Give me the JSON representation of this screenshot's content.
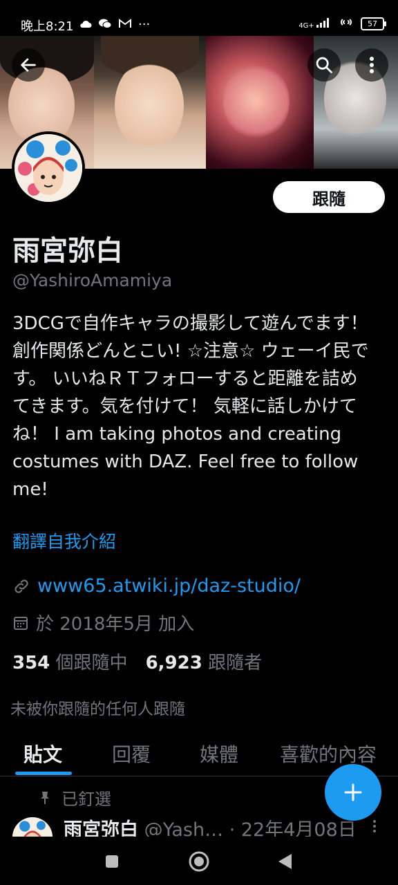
{
  "status": {
    "time": "晚上8:21",
    "network": "4G+",
    "battery": "57"
  },
  "profile": {
    "display_name": "雨宮弥白",
    "handle": "@YashiroAmamiya",
    "bio": "3DCGで自作キャラの撮影して遊んでます！創作関係どんとこい! ☆注意☆ ウェーイ民です。 いいねＲＴフォローすると距離を詰めてきます。気を付けて！ 気軽に話しかけてね！ I am taking photos and creating costumes with DAZ. Feel free to follow me!",
    "translate_label": "翻譯自我介紹",
    "website": "www65.atwiki.jp/daz-studio/",
    "joined": "於 2018年5月 加入",
    "following_count": "354",
    "following_label": "個跟隨中",
    "followers_count": "6,923",
    "followers_label": "跟隨者",
    "not_followed_note": "未被你跟隨的任何人跟隨",
    "follow_button": "跟隨"
  },
  "tabs": [
    {
      "label": "貼文",
      "active": true
    },
    {
      "label": "回覆",
      "active": false
    },
    {
      "label": "媒體",
      "active": false
    },
    {
      "label": "喜歡的內容",
      "active": false
    }
  ],
  "pinned_tweet": {
    "pinned_label": "已釘選",
    "name": "雨宮弥白",
    "handle": "@Yash…",
    "date": "· 22年4月08日"
  },
  "colors": {
    "accent": "#1d9bf0",
    "background": "#000000",
    "text_primary": "#e7e9ea",
    "text_secondary": "#71767b"
  },
  "icons": [
    "back-arrow-icon",
    "search-icon",
    "more-vertical-icon",
    "link-icon",
    "calendar-icon",
    "pin-icon",
    "compose-plus-icon",
    "nav-recents-icon",
    "nav-home-icon",
    "nav-back-icon"
  ]
}
